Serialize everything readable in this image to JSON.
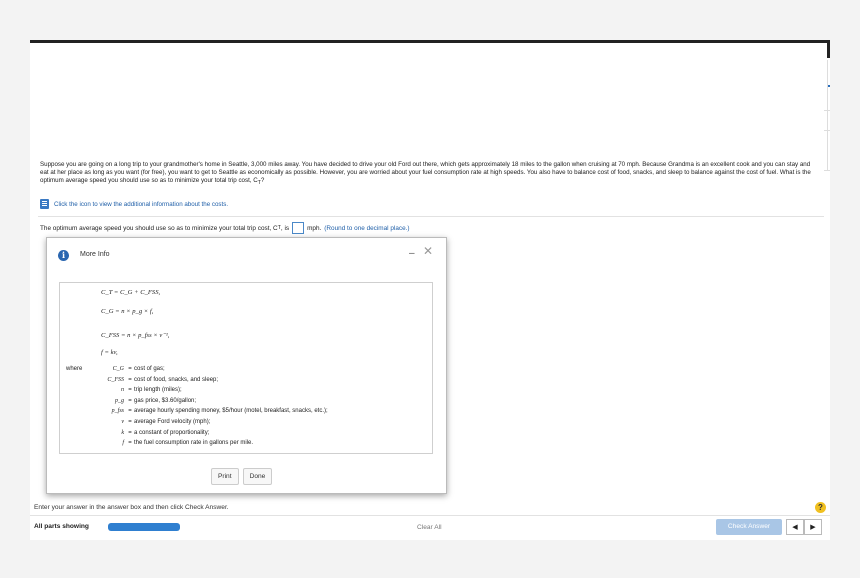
{
  "problem": {
    "text": "Suppose you are going on a long trip to your grandmother's home in Seattle, 3,000 miles away. You have decided to drive your old Ford out there, which gets approximately 18 miles to the gallon when cruising at 70 mph. Because Grandma is an excellent cook and you can stay and eat at her place as long as you want (for free), you want to get to Seattle as economically as possible. However, you are worried about your fuel consumption rate at high speeds. You also have to balance cost of food, snacks, and sleep to balance against the cost of fuel. What is the optimum average speed you should use so as to minimize your total trip cost, C",
    "sub": "T",
    "end": "?"
  },
  "info_link": "Click the icon to view the additional information about the costs.",
  "question": {
    "before": "The optimum average speed you should use so as to minimize your total trip cost, C",
    "sub": "T",
    "mid": ", is",
    "unit": "mph.",
    "note": "(Round to one decimal place.)"
  },
  "modal": {
    "title": "More Info",
    "minimize": "–",
    "close": "✕",
    "equations": [
      "C_T = C_G + C_FSS,",
      "C_G = n × p_g × f,",
      "C_FSS = n × p_fss × v⁻¹,",
      "f = kv,"
    ],
    "where": "where",
    "definitions": [
      {
        "sym": "C_G",
        "desc": "cost of gas;"
      },
      {
        "sym": "C_FSS",
        "desc": "cost of food, snacks, and sleep;"
      },
      {
        "sym": "n",
        "desc": "trip length (miles);"
      },
      {
        "sym": "p_g",
        "desc": "gas price, $3.60/gallon;"
      },
      {
        "sym": "p_fss",
        "desc": "average hourly spending money, $5/hour (motel, breakfast, snacks, etc.);"
      },
      {
        "sym": "v",
        "desc": "average Ford velocity (mph);"
      },
      {
        "sym": "k",
        "desc": "a constant of proportionality;"
      },
      {
        "sym": "f",
        "desc": "the fuel consumption rate in gallons per mile."
      }
    ],
    "print_label": "Print",
    "done_label": "Done"
  },
  "footer": {
    "instruction": "Enter your answer in the answer box and then click Check Answer.",
    "help": "?",
    "all_parts": "All parts showing",
    "progress": 1.0,
    "clear_all": "Clear All",
    "check_answer": "Check Answer",
    "prev": "◀",
    "next": "▶"
  },
  "colors": {
    "accent": "#2f7fd0",
    "link": "#1f5fa8",
    "help": "#f0c020",
    "check_disabled": "#a9c6e6"
  }
}
